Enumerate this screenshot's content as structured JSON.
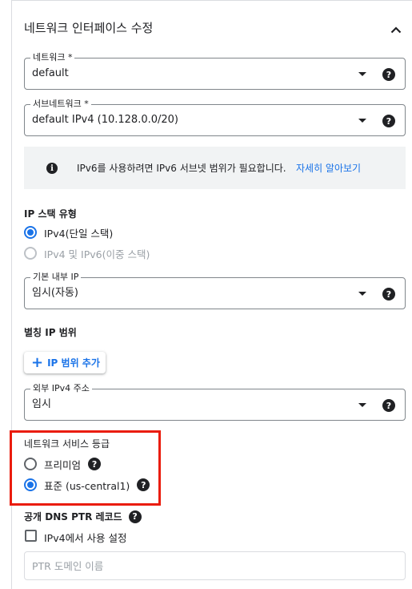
{
  "section": {
    "title": "네트워크 인터페이스 수정",
    "collapse_icon": "chevron-up-icon"
  },
  "network": {
    "label": "네트워크 *",
    "value": "default"
  },
  "subnetwork": {
    "label": "서브네트워크 *",
    "value": "default IPv4 (10.128.0.0/20)"
  },
  "ipv6_notice": {
    "icon": "info-icon",
    "text": "IPv6를 사용하려면 IPv6 서브넷 범위가 필요합니다.",
    "link": "자세히 알아보기"
  },
  "ip_stack": {
    "label": "IP 스택 유형",
    "options": [
      {
        "label": "IPv4(단일 스택)",
        "selected": true,
        "disabled": false
      },
      {
        "label": "IPv4 및 IPv6(이중 스택)",
        "selected": false,
        "disabled": true
      }
    ]
  },
  "primary_internal_ip": {
    "label": "기본 내부 IP",
    "value": "임시(자동)"
  },
  "alias_ip": {
    "label": "별칭 IP 범위",
    "add_button": "IP 범위 추가"
  },
  "external_ipv4": {
    "label": "외부 IPv4 주소",
    "value": "임시"
  },
  "network_tier": {
    "label": "네트워크 서비스 등급",
    "options": [
      {
        "label": "프리미엄",
        "selected": false
      },
      {
        "label": "표준 (us-central1)",
        "selected": true
      }
    ]
  },
  "dns_ptr": {
    "label": "공개 DNS PTR 레코드",
    "checkbox_label": "IPv4에서 사용 설정",
    "checked": false,
    "placeholder": "PTR 도메인 이름"
  },
  "help_glyph": "?",
  "info_glyph": "i",
  "plus_glyph": "+",
  "colors": {
    "accent": "#1a73e8",
    "highlight_border": "#ea1c0d",
    "text": "#202124",
    "disabled": "#9aa0a6"
  }
}
